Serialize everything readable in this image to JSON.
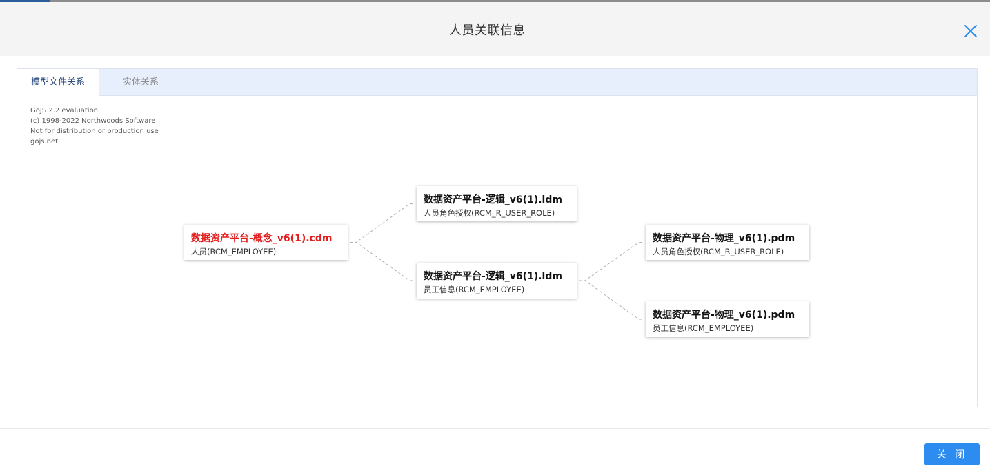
{
  "dialog": {
    "title": "人员关联信息",
    "close_button_label": "关 闭"
  },
  "tabs": [
    {
      "label": "模型文件关系",
      "active": true
    },
    {
      "label": "实体关系",
      "active": false
    }
  ],
  "watermark": [
    "GoJS 2.2 evaluation",
    "(c) 1998-2022 Northwoods Software",
    "Not for distribution or production use",
    "gojs.net"
  ],
  "nodes": [
    {
      "title": "数据资产平台-概念_v6(1).cdm",
      "subtitle": "人员(RCM_EMPLOYEE)",
      "is_root": true
    },
    {
      "title": "数据资产平台-逻辑_v6(1).ldm",
      "subtitle": "人员角色授权(RCM_R_USER_ROLE)",
      "is_root": false
    },
    {
      "title": "数据资产平台-逻辑_v6(1).ldm",
      "subtitle": "员工信息(RCM_EMPLOYEE)",
      "is_root": false
    },
    {
      "title": "数据资产平台-物理_v6(1).pdm",
      "subtitle": "人员角色授权(RCM_R_USER_ROLE)",
      "is_root": false
    },
    {
      "title": "数据资产平台-物理_v6(1).pdm",
      "subtitle": "员工信息(RCM_EMPLOYEE)",
      "is_root": false
    }
  ],
  "links": [
    [
      0,
      1
    ],
    [
      0,
      2
    ],
    [
      2,
      3
    ],
    [
      2,
      4
    ]
  ],
  "colors": {
    "accent": "#2d8cf0",
    "root_title": "#e31c1c",
    "tab_bar": "#e8effc",
    "link": "#b0b0b0"
  }
}
